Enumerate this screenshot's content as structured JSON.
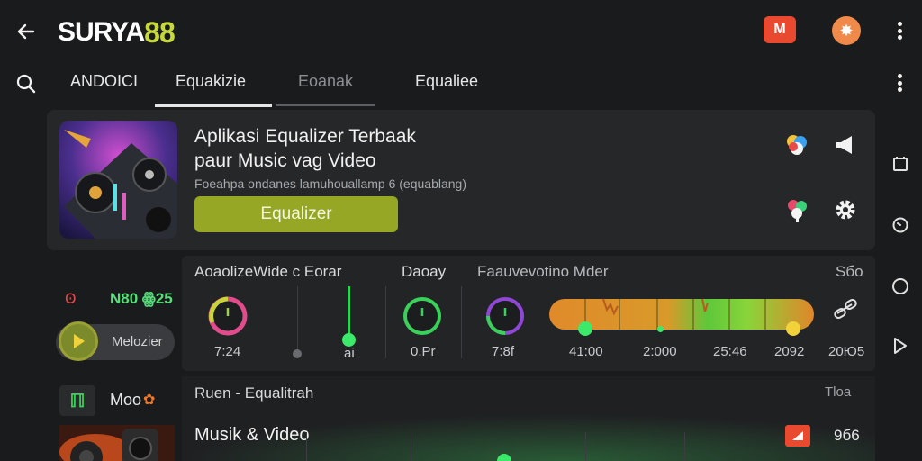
{
  "app": {
    "brand_part1": "SURYA",
    "brand_part2": "88",
    "badge_label": "M",
    "avatar_glyph": "✸"
  },
  "tabs": [
    {
      "label": "ANDOICI"
    },
    {
      "label": "Equakizie"
    },
    {
      "label": "Eoanak"
    },
    {
      "label": "Equaliee"
    }
  ],
  "feature_card": {
    "title_line1": "Aplikasi Equalizer Terbaak",
    "title_line2": "paur Music vag Video",
    "subtitle": "Foeahpa ondanes lamuhouallamp 6 (equablang)",
    "button_label": "Equalizer"
  },
  "mixer": {
    "left_code_prefix": "Ꙩ",
    "left_code": "N80 ꙮ25",
    "melodizer_label": "Melozier",
    "header_title": "AoaolizeWide c Eorar",
    "header_mid": "Daoay",
    "header_right": "Faauvevotino Mder",
    "header_far": "Sбo",
    "knobs": [
      {
        "value": "7:24",
        "ring": "#e04c8c"
      },
      {
        "value": "0.Pr",
        "ring": "#39d15a"
      },
      {
        "value": "7:8f",
        "ring": "#8f47d6"
      }
    ],
    "fader_label": "ai",
    "timeline_ticks": [
      "41:00",
      "2:000",
      "25:46",
      "2092"
    ],
    "timeline_end": "20Ю5"
  },
  "playlist": {
    "left_label": "Moo",
    "left_icon_glyph": "ℿ",
    "header_title": "Ruen - Equalitrah",
    "header_right": "Тloa",
    "item_title": "Musik & Video",
    "item_count": "9б6"
  },
  "colors": {
    "accent_green": "#96a625",
    "brand_yellow": "#c7d93a",
    "badge_red": "#e9492e"
  }
}
